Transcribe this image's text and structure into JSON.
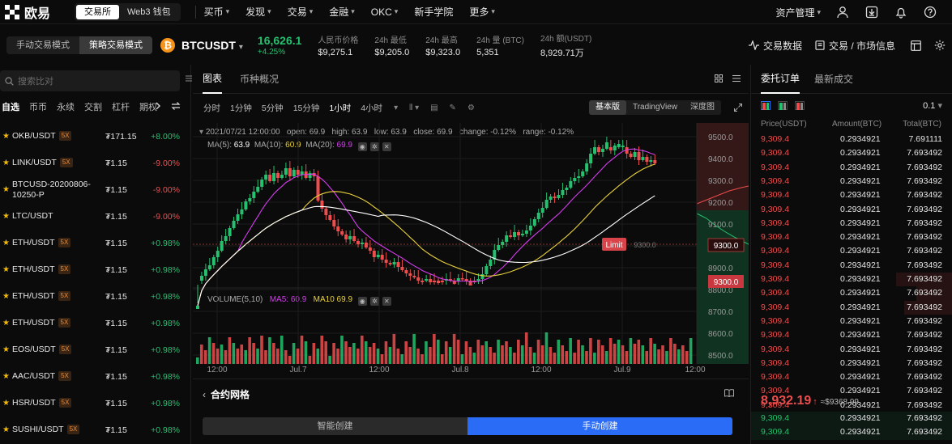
{
  "nav": {
    "brand": "欧易",
    "mode_exchange": "交易所",
    "mode_web3": "Web3 钱包",
    "items": [
      "买币",
      "发现",
      "交易",
      "金融",
      "OKC",
      "新手学院",
      "更多"
    ],
    "asset_manage": "资产管理"
  },
  "ticker": {
    "mode_manual": "手动交易模式",
    "mode_strategy": "策略交易模式",
    "coin_symbol": "₿",
    "pair": "BTCUSDT",
    "last_price": "16,626.1",
    "change_pct": "+4.25%",
    "stats": [
      {
        "label": "人民币价格",
        "value": "$9,275.1"
      },
      {
        "label": "24h 最低",
        "value": "$9,205.0"
      },
      {
        "label": "24h 最高",
        "value": "$9,323.0"
      },
      {
        "label": "24h 量 (BTC)",
        "value": "5,351"
      },
      {
        "label": "24h 额(USDT)",
        "value": "8,929.71万"
      }
    ],
    "trade_data": "交易数据",
    "trade_market": "交易 / 市场信息"
  },
  "left": {
    "search_placeholder": "搜索比对",
    "tabs": [
      "自选",
      "币币",
      "永续",
      "交割",
      "杠杆",
      "期权"
    ],
    "markets": [
      {
        "name": "OKB/USDT",
        "badge": "5X",
        "price": "₮171.15",
        "change": "+8.00%",
        "dir": "up"
      },
      {
        "name": "LINK/USDT",
        "badge": "5X",
        "price": "₮1.15",
        "change": "-9.00%",
        "dir": "down"
      },
      {
        "name": "BTCUSD-20200806-",
        "name2": "10250-P",
        "badge": "",
        "price": "₮1.15",
        "change": "-9.00%",
        "dir": "down"
      },
      {
        "name": "LTC/USDT",
        "badge": "",
        "price": "₮1.15",
        "change": "-9.00%",
        "dir": "down"
      },
      {
        "name": "ETH/USDT",
        "badge": "5X",
        "price": "₮1.15",
        "change": "+0.98%",
        "dir": "up"
      },
      {
        "name": "ETH/USDT",
        "badge": "5X",
        "price": "₮1.15",
        "change": "+0.98%",
        "dir": "up"
      },
      {
        "name": "ETH/USDT",
        "badge": "5X",
        "price": "₮1.15",
        "change": "+0.98%",
        "dir": "up"
      },
      {
        "name": "ETH/USDT",
        "badge": "5X",
        "price": "₮1.15",
        "change": "+0.98%",
        "dir": "up"
      },
      {
        "name": "EOS/USDT",
        "badge": "5X",
        "price": "₮1.15",
        "change": "+0.98%",
        "dir": "up"
      },
      {
        "name": "AAC/USDT",
        "badge": "5X",
        "price": "₮1.15",
        "change": "+0.98%",
        "dir": "up"
      },
      {
        "name": "HSR/USDT",
        "badge": "5X",
        "price": "₮1.15",
        "change": "+0.98%",
        "dir": "up"
      },
      {
        "name": "SUSHI/USDT",
        "badge": "5X",
        "price": "₮1.15",
        "change": "+0.98%",
        "dir": "up"
      }
    ]
  },
  "chart": {
    "tabs": [
      "图表",
      "币种概况"
    ],
    "intervals": [
      "分时",
      "1分钟",
      "5分钟",
      "15分钟",
      "1小时",
      "4小时"
    ],
    "active_interval": "1小时",
    "views": [
      "基本版",
      "TradingView",
      "深度图"
    ],
    "ohlc": {
      "time": "2021/07/21 12:00:00",
      "open": "open: 69.9",
      "high": "high: 63.9",
      "low": "low: 63.9",
      "close": "close: 69.9",
      "change": "change: -0.12%",
      "range": "range: -0.12%"
    },
    "ma": {
      "ma5_label": "MA(5):",
      "ma5": "63.9",
      "ma10_label": "MA(10):",
      "ma10": "60.9",
      "ma20_label": "MA(20):",
      "ma20": "69.9"
    },
    "volume": {
      "label": "VOLUME(5,10)",
      "ma5": "MA5: 60.9",
      "ma10": "MA10 69.9"
    },
    "price_axis": [
      "9500.0",
      "9400.0",
      "9300.0",
      "9200.0",
      "9100.0",
      "9000.0",
      "8900.0",
      "8800.0",
      "8700.0",
      "8600.0",
      "8500.0"
    ],
    "x_axis": [
      "12:00",
      "Jul.7",
      "12:00",
      "Jul.8",
      "12:00",
      "Jul.9",
      "12:00"
    ],
    "limit_label": "Limit",
    "limit_value": "9300.0",
    "price_tag_1": "9300.0",
    "price_tag_2": "9300.0",
    "colors": {
      "up": "#25c16f",
      "down": "#ee4d4d",
      "ma5": "#ffffff",
      "ma10": "#e8d13a",
      "ma20": "#d63cf0"
    }
  },
  "grid": {
    "title": "合约网格",
    "smart": "智能创建",
    "manual": "手动创建"
  },
  "orderbook": {
    "tabs": [
      "委托订单",
      "最新成交"
    ],
    "precision": "0.1",
    "headers": {
      "price": "Price(USDT)",
      "amount": "Amount(BTC)",
      "total": "Total(BTC)"
    },
    "asks": [
      {
        "price": "9,309.4",
        "amount": "0.2934921",
        "total": "7.691111"
      },
      {
        "price": "9,309.4",
        "amount": "0.2934921",
        "total": "7.693492"
      },
      {
        "price": "9,309.4",
        "amount": "0.2934921",
        "total": "7.693492"
      },
      {
        "price": "9,309.4",
        "amount": "0.2934921",
        "total": "7.693492"
      },
      {
        "price": "9,309.4",
        "amount": "0.2934921",
        "total": "7.693492"
      },
      {
        "price": "9,309.4",
        "amount": "0.2934921",
        "total": "7.693492"
      },
      {
        "price": "9,309.4",
        "amount": "0.2934921",
        "total": "7.693492"
      },
      {
        "price": "9,309.4",
        "amount": "0.2934921",
        "total": "7.693492"
      },
      {
        "price": "9,309.4",
        "amount": "0.2934921",
        "total": "7.693492"
      },
      {
        "price": "9,309.4",
        "amount": "0.2934921",
        "total": "7.693492"
      },
      {
        "price": "9,309.4",
        "amount": "0.2934921",
        "total": "7.693492"
      },
      {
        "price": "9,309.4",
        "amount": "0.2934921",
        "total": "7.693492"
      },
      {
        "price": "9,309.4",
        "amount": "0.2934921",
        "total": "7.693492"
      },
      {
        "price": "9,309.4",
        "amount": "0.2934921",
        "total": "7.693492"
      },
      {
        "price": "9,309.4",
        "amount": "0.2934921",
        "total": "7.693492"
      },
      {
        "price": "9,309.4",
        "amount": "0.2934921",
        "total": "7.693492"
      },
      {
        "price": "9,309.4",
        "amount": "0.2934921",
        "total": "7.693492"
      },
      {
        "price": "9,309.4",
        "amount": "0.2934921",
        "total": "7.693492"
      },
      {
        "price": "9,309.4",
        "amount": "0.2934921",
        "total": "7.693492"
      },
      {
        "price": "9,309.4",
        "amount": "0.2934921",
        "total": "7.693492"
      }
    ],
    "mid_price": "8,932.19",
    "mid_arrow": "↑",
    "mid_ref": "≈$9368.99",
    "bids": [
      {
        "price": "9,309.4",
        "amount": "0.2934921",
        "total": "7.693492"
      },
      {
        "price": "9,309.4",
        "amount": "0.2934921",
        "total": "7.693492"
      }
    ]
  }
}
